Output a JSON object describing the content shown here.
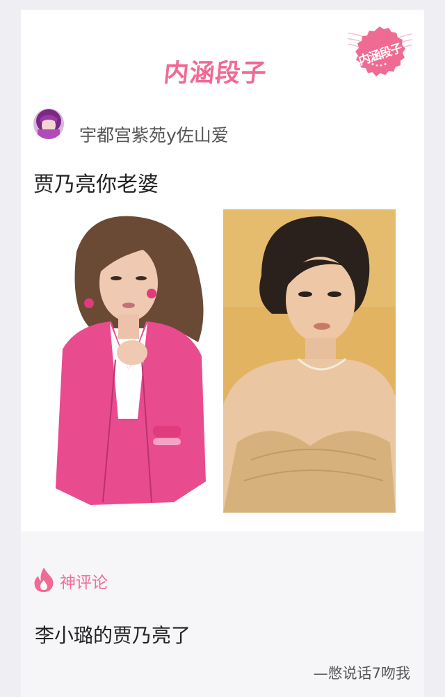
{
  "header": {
    "brand": "内涵段子",
    "stamp_text": "内涵段子"
  },
  "post": {
    "author_name": "宇都宫紫苑y佐山爱",
    "text": "贾乃亮你老婆"
  },
  "comment_section": {
    "label": "神评论",
    "comment_text": "李小璐的贾乃亮了",
    "comment_author": "—憋说话7吻我"
  },
  "colors": {
    "accent": "#f06b93",
    "page_bg": "#efeef2",
    "comment_bg": "#f6f6f8"
  },
  "icons": {
    "fire": "fire-icon",
    "stamp": "stamp-icon"
  }
}
